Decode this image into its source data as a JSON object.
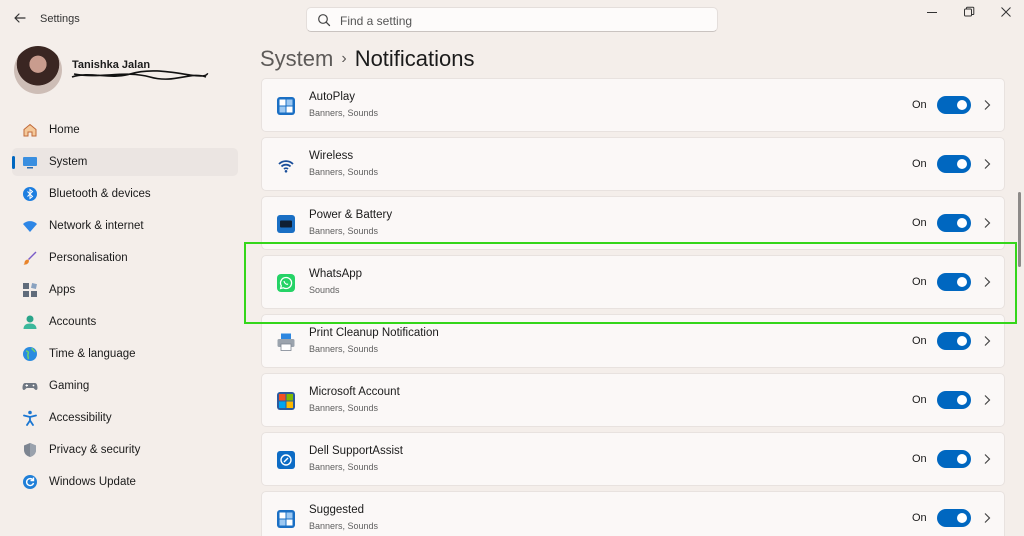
{
  "window": {
    "title": "Settings"
  },
  "search": {
    "placeholder": "Find a setting"
  },
  "user": {
    "name": "Tanishka Jalan",
    "email": ""
  },
  "sidebar": {
    "items": [
      {
        "label": "Home",
        "icon": "home-icon",
        "active": false
      },
      {
        "label": "System",
        "icon": "system-icon",
        "active": true
      },
      {
        "label": "Bluetooth & devices",
        "icon": "bluetooth-icon",
        "active": false
      },
      {
        "label": "Network & internet",
        "icon": "wifi-icon",
        "active": false
      },
      {
        "label": "Personalisation",
        "icon": "brush-icon",
        "active": false
      },
      {
        "label": "Apps",
        "icon": "apps-icon",
        "active": false
      },
      {
        "label": "Accounts",
        "icon": "accounts-icon",
        "active": false
      },
      {
        "label": "Time & language",
        "icon": "globe-icon",
        "active": false
      },
      {
        "label": "Gaming",
        "icon": "controller-icon",
        "active": false
      },
      {
        "label": "Accessibility",
        "icon": "accessibility-icon",
        "active": false
      },
      {
        "label": "Privacy & security",
        "icon": "shield-icon",
        "active": false
      },
      {
        "label": "Windows Update",
        "icon": "update-icon",
        "active": false
      }
    ]
  },
  "breadcrumb": {
    "parent": "System",
    "separator": "›",
    "current": "Notifications"
  },
  "notifications": {
    "items": [
      {
        "name": "AutoPlay",
        "sub": "Banners, Sounds",
        "state": "On",
        "enabled": true,
        "icon": "autoplay-icon"
      },
      {
        "name": "Wireless",
        "sub": "Banners, Sounds",
        "state": "On",
        "enabled": true,
        "icon": "wireless-icon"
      },
      {
        "name": "Power & Battery",
        "sub": "Banners, Sounds",
        "state": "On",
        "enabled": true,
        "icon": "battery-icon"
      },
      {
        "name": "WhatsApp",
        "sub": "Sounds",
        "state": "On",
        "enabled": true,
        "icon": "whatsapp-icon"
      },
      {
        "name": "Print Cleanup Notification",
        "sub": "Banners, Sounds",
        "state": "On",
        "enabled": true,
        "icon": "printer-icon"
      },
      {
        "name": "Microsoft Account",
        "sub": "Banners, Sounds",
        "state": "On",
        "enabled": true,
        "icon": "microsoft-icon"
      },
      {
        "name": "Dell SupportAssist",
        "sub": "Banners, Sounds",
        "state": "On",
        "enabled": true,
        "icon": "supportassist-icon"
      },
      {
        "name": "Suggested",
        "sub": "Banners, Sounds",
        "state": "On",
        "enabled": true,
        "icon": "suggested-icon"
      }
    ]
  },
  "colors": {
    "accent": "#0067c0",
    "highlight": "#34d61a",
    "background": "#f4eeea"
  }
}
